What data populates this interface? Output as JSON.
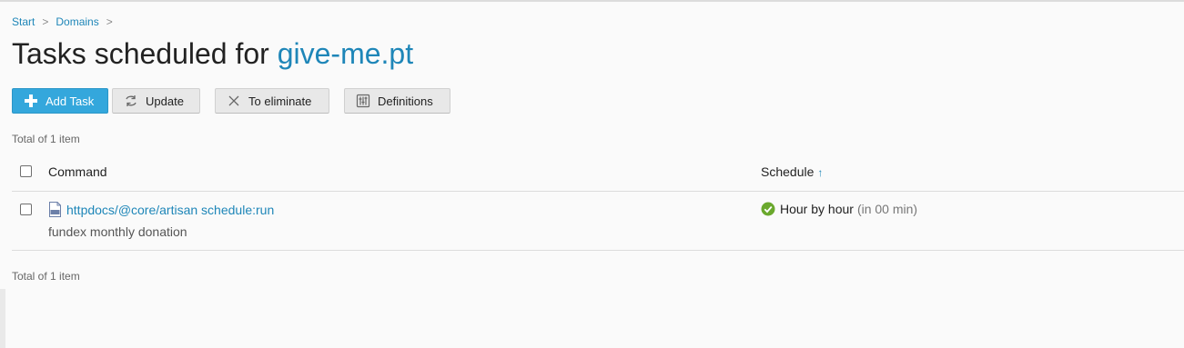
{
  "breadcrumb": {
    "items": [
      "Start",
      "Domains"
    ],
    "separator": ">"
  },
  "page": {
    "title_prefix": "Tasks scheduled for",
    "domain": "give-me.pt"
  },
  "toolbar": {
    "add_label": "Add Task",
    "update_label": "Update",
    "eliminate_label": "To eliminate",
    "definitions_label": "Definitions"
  },
  "summary": {
    "top": "Total of 1 item",
    "bottom": "Total of 1 item"
  },
  "table": {
    "columns": {
      "command": "Command",
      "schedule": "Schedule",
      "sort_indicator": "↑"
    },
    "rows": [
      {
        "command": "httpdocs/@core/artisan schedule:run",
        "description": "fundex monthly donation",
        "schedule": "Hour by hour",
        "schedule_hint": "(in 00 min)",
        "status_icon": "check-circle-icon",
        "file_icon": "php-file-icon"
      }
    ]
  },
  "colors": {
    "link": "#1e86b8",
    "primary_button": "#34a7dc",
    "success": "#6aa82d"
  }
}
